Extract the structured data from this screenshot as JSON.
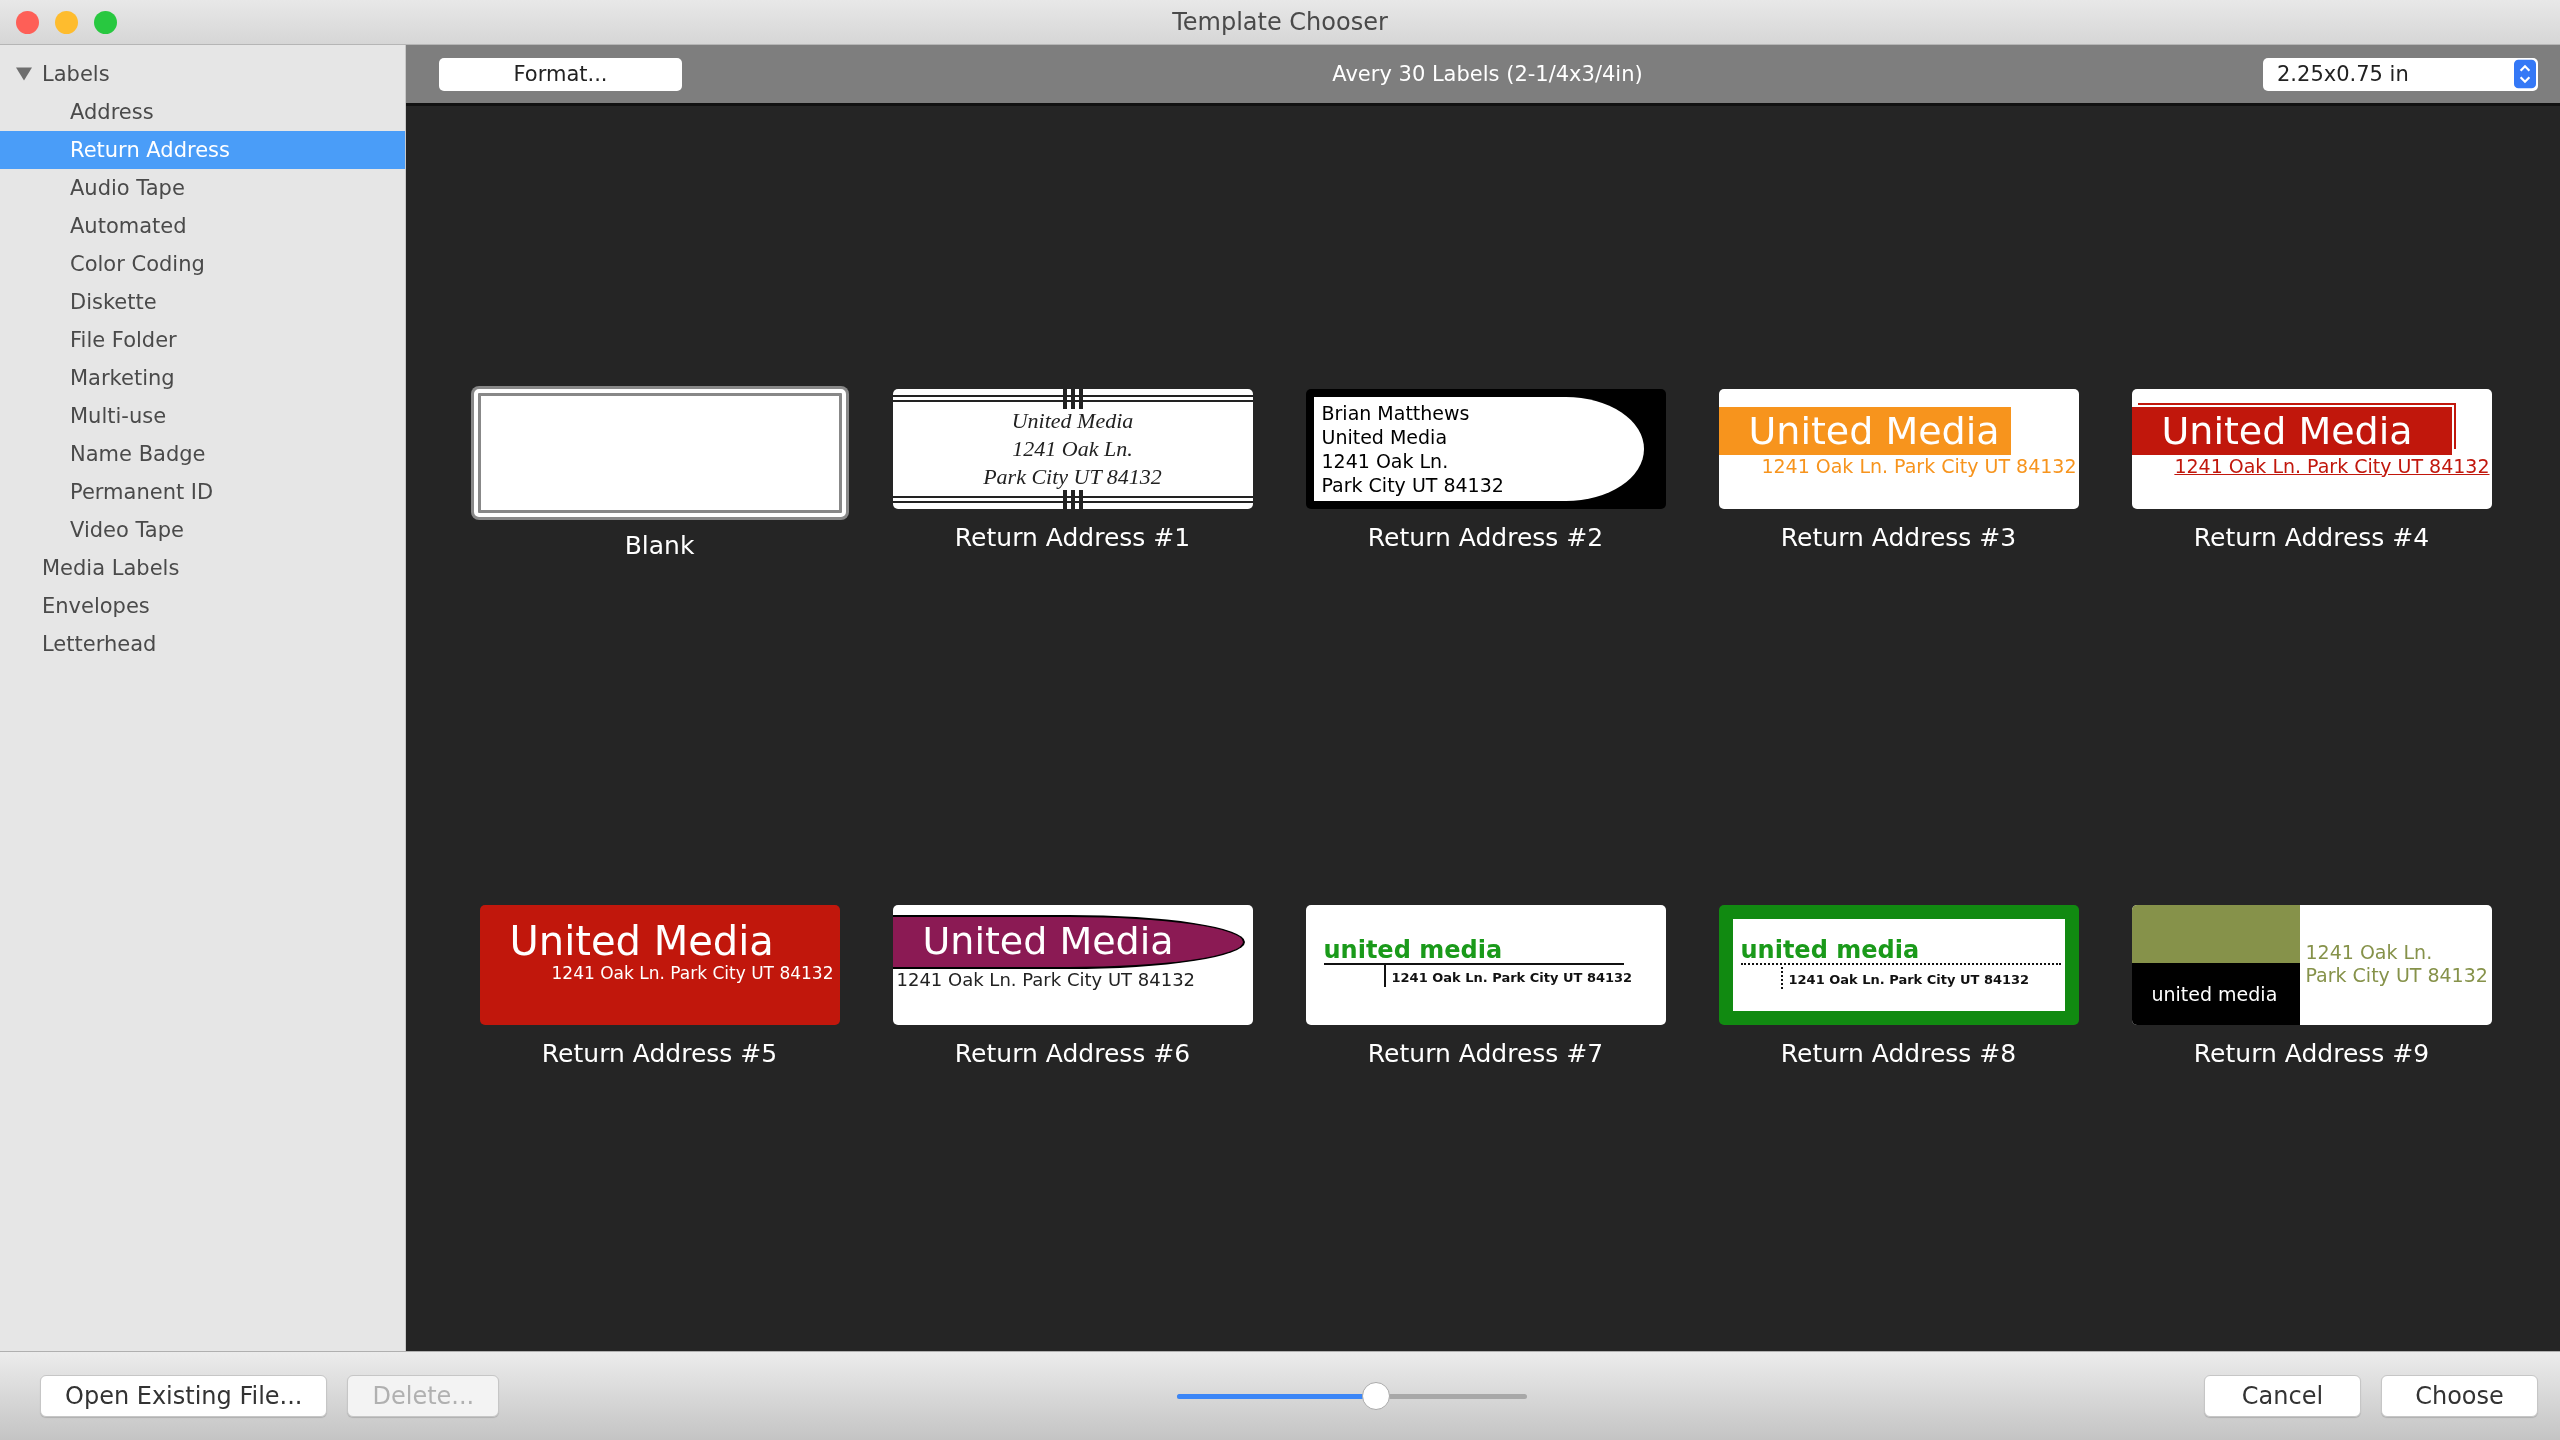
{
  "window": {
    "title": "Template Chooser"
  },
  "sidebar": {
    "items": [
      {
        "label": "Labels",
        "selected": false,
        "expanded": true,
        "children": [
          {
            "label": "Address",
            "selected": false
          },
          {
            "label": "Return Address",
            "selected": true
          },
          {
            "label": "Audio Tape",
            "selected": false
          },
          {
            "label": "Automated",
            "selected": false
          },
          {
            "label": "Color Coding",
            "selected": false
          },
          {
            "label": "Diskette",
            "selected": false
          },
          {
            "label": "File Folder",
            "selected": false
          },
          {
            "label": "Marketing",
            "selected": false
          },
          {
            "label": "Multi-use",
            "selected": false
          },
          {
            "label": "Name Badge",
            "selected": false
          },
          {
            "label": "Permanent ID",
            "selected": false
          },
          {
            "label": "Video Tape",
            "selected": false
          }
        ]
      },
      {
        "label": "Media Labels",
        "selected": false
      },
      {
        "label": "Envelopes",
        "selected": false
      },
      {
        "label": "Letterhead",
        "selected": false
      }
    ]
  },
  "toolbar": {
    "format_button": "Format...",
    "title": "Avery 30 Labels (2-1/4x3/4in)",
    "size_select": "2.25x0.75 in"
  },
  "templates": [
    {
      "name": "Blank",
      "kind": "blank",
      "selected": true
    },
    {
      "name": "Return Address #1",
      "kind": "classic",
      "selected": false,
      "lines": [
        "United Media",
        "1241 Oak Ln.",
        "Park City UT 84132"
      ]
    },
    {
      "name": "Return Address #2",
      "kind": "block",
      "selected": false,
      "lines": [
        "Brian Matthews",
        "United Media",
        "1241 Oak Ln.",
        "Park City UT 84132"
      ]
    },
    {
      "name": "Return Address #3",
      "kind": "orange-band",
      "selected": false,
      "lines": [
        "United Media",
        "1241 Oak Ln. Park City UT 84132"
      ]
    },
    {
      "name": "Return Address #4",
      "kind": "red-band",
      "selected": false,
      "lines": [
        "United Media",
        "1241 Oak Ln. Park City UT 84132"
      ]
    },
    {
      "name": "Return Address #5",
      "kind": "red-solid",
      "selected": false,
      "lines": [
        "United Media",
        "1241 Oak Ln. Park City UT 84132"
      ]
    },
    {
      "name": "Return Address #6",
      "kind": "ellipse",
      "selected": false,
      "lines": [
        "United Media",
        "1241 Oak Ln. Park City UT 84132"
      ]
    },
    {
      "name": "Return Address #7",
      "kind": "tee",
      "selected": false,
      "lines": [
        "united media",
        "1241 Oak Ln. Park City UT 84132"
      ]
    },
    {
      "name": "Return Address #8",
      "kind": "green-border",
      "selected": false,
      "lines": [
        "united media",
        "1241 Oak Ln. Park City UT 84132"
      ]
    },
    {
      "name": "Return Address #9",
      "kind": "olive",
      "selected": false,
      "lines": [
        "united media",
        "1241 Oak Ln.",
        "Park City UT 84132"
      ]
    }
  ],
  "footer": {
    "open_button": "Open Existing File...",
    "delete_button": {
      "label": "Delete...",
      "disabled": true
    },
    "zoom_slider": {
      "level": 0.57
    },
    "cancel_button": "Cancel",
    "choose_button": "Choose"
  }
}
